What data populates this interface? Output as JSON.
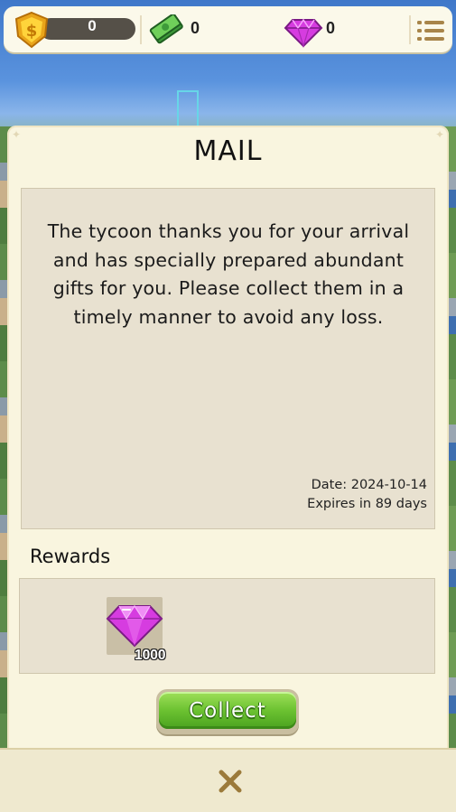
{
  "hud": {
    "coins": "0",
    "cash": "0",
    "gems": "0",
    "icons": {
      "coins": "gold-shield-coin-icon",
      "cash": "cash-stack-icon",
      "gems": "purple-gem-icon",
      "menu": "list-menu-icon"
    }
  },
  "mail": {
    "title": "MAIL",
    "message": "The tycoon thanks you for your arrival and has specially prepared abundant gifts for you. Please collect them in a timely manner to avoid any loss.",
    "date": "Date:  2024-10-14",
    "expires": "Expires in 89 days",
    "rewards_label": "Rewards",
    "rewards": [
      {
        "icon": "purple-gem-icon",
        "count": "1000"
      }
    ],
    "collect_label": "Collect"
  },
  "bottom": {
    "close_icon": "close-x-icon"
  },
  "colors": {
    "panel_bg": "#f9f5df",
    "box_bg": "#e8e1d0",
    "collect_green": "#6cc231",
    "gem_purple": "#d63ce0",
    "close_x": "#9b7a3a"
  }
}
